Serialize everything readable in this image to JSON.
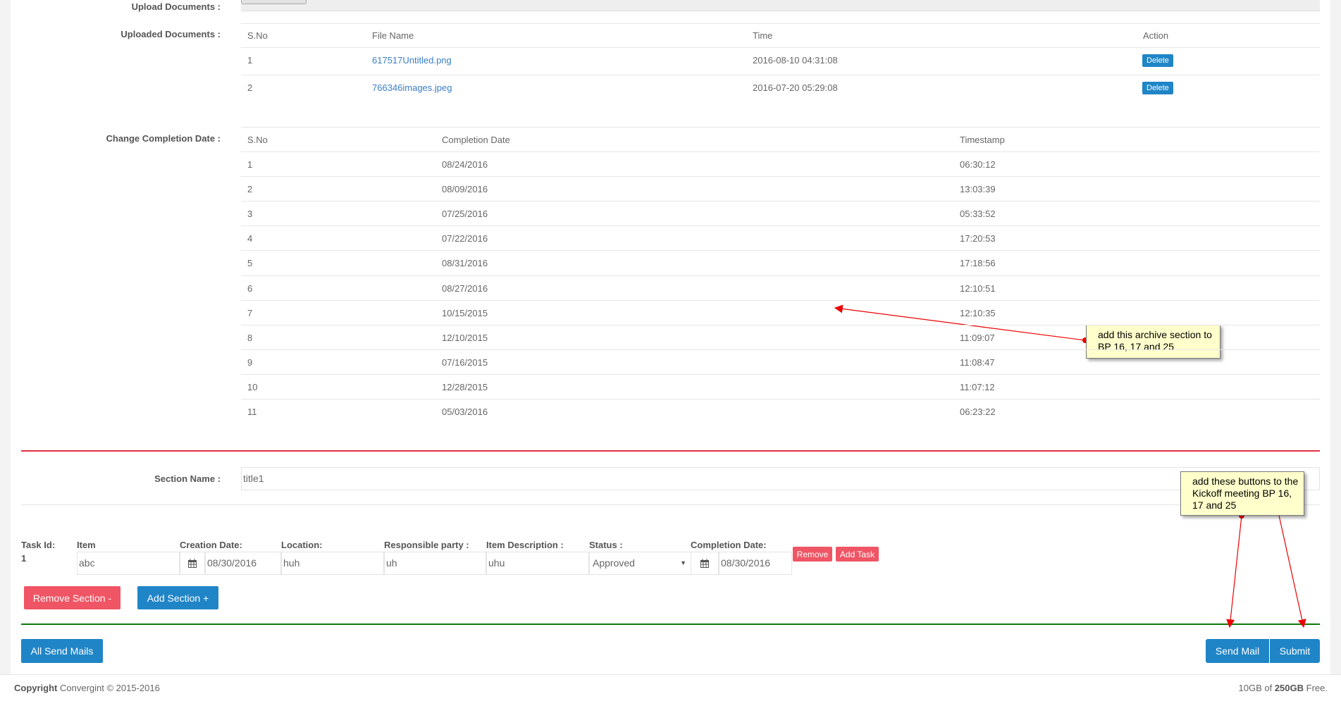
{
  "upload": {
    "label": "Upload Documents :"
  },
  "uploaded": {
    "label": "Uploaded Documents :",
    "headers": [
      "S.No",
      "File Name",
      "Time",
      "Action"
    ],
    "rows": [
      {
        "sno": "1",
        "file": "617517Untitled.png",
        "time": "2016-08-10 04:31:08",
        "action": "Delete"
      },
      {
        "sno": "2",
        "file": "766346images.jpeg",
        "time": "2016-07-20 05:29:08",
        "action": "Delete"
      }
    ]
  },
  "completion": {
    "label": "Change Completion Date :",
    "headers": [
      "S.No",
      "Completion Date",
      "Timestamp"
    ],
    "rows": [
      [
        "1",
        "08/24/2016",
        "06:30:12"
      ],
      [
        "2",
        "08/09/2016",
        "13:03:39"
      ],
      [
        "3",
        "07/25/2016",
        "05:33:52"
      ],
      [
        "4",
        "07/22/2016",
        "17:20:53"
      ],
      [
        "5",
        "08/31/2016",
        "17:18:56"
      ],
      [
        "6",
        "08/27/2016",
        "12:10:51"
      ],
      [
        "7",
        "10/15/2015",
        "12:10:35"
      ],
      [
        "8",
        "12/10/2015",
        "11:09:07"
      ],
      [
        "9",
        "07/16/2015",
        "11:08:47"
      ],
      [
        "10",
        "12/28/2015",
        "11:07:12"
      ],
      [
        "11",
        "05/03/2016",
        "06:23:22"
      ]
    ]
  },
  "section": {
    "label": "Section Name :",
    "value": "title1"
  },
  "task": {
    "labels": {
      "id": "Task Id:",
      "item": "Item",
      "creation": "Creation Date:",
      "location": "Location:",
      "party": "Responsible party :",
      "desc": "Item Description :",
      "status": "Status :",
      "completion": "Completion Date:"
    },
    "id": "1",
    "item": "abc",
    "creation": "08/30/2016",
    "location": "huh",
    "party": "uh",
    "desc": "uhu",
    "status": "Approved",
    "completion": "08/30/2016",
    "remove": "Remove",
    "add": "Add Task"
  },
  "buttons": {
    "remove_section": "Remove Section -",
    "add_section": "Add Section +",
    "all_send": "All Send Mails",
    "send_mail": "Send Mail",
    "submit": "Submit"
  },
  "footer": {
    "copyright_bold": "Copyright",
    "copyright": " Convergint © 2015-2016",
    "storage_pre": "10GB of ",
    "storage_bold": "250GB",
    "storage_post": " Free."
  },
  "annotations": [
    "add this archive section to BP 16, 17 and 25",
    "add these buttons to the Kickoff meeting BP 16, 17 and 25"
  ],
  "colors": {
    "primary": "#1f85c7",
    "danger": "#ef5565",
    "divider_red": "#e0303f",
    "divider_green": "#0b7a0b"
  }
}
